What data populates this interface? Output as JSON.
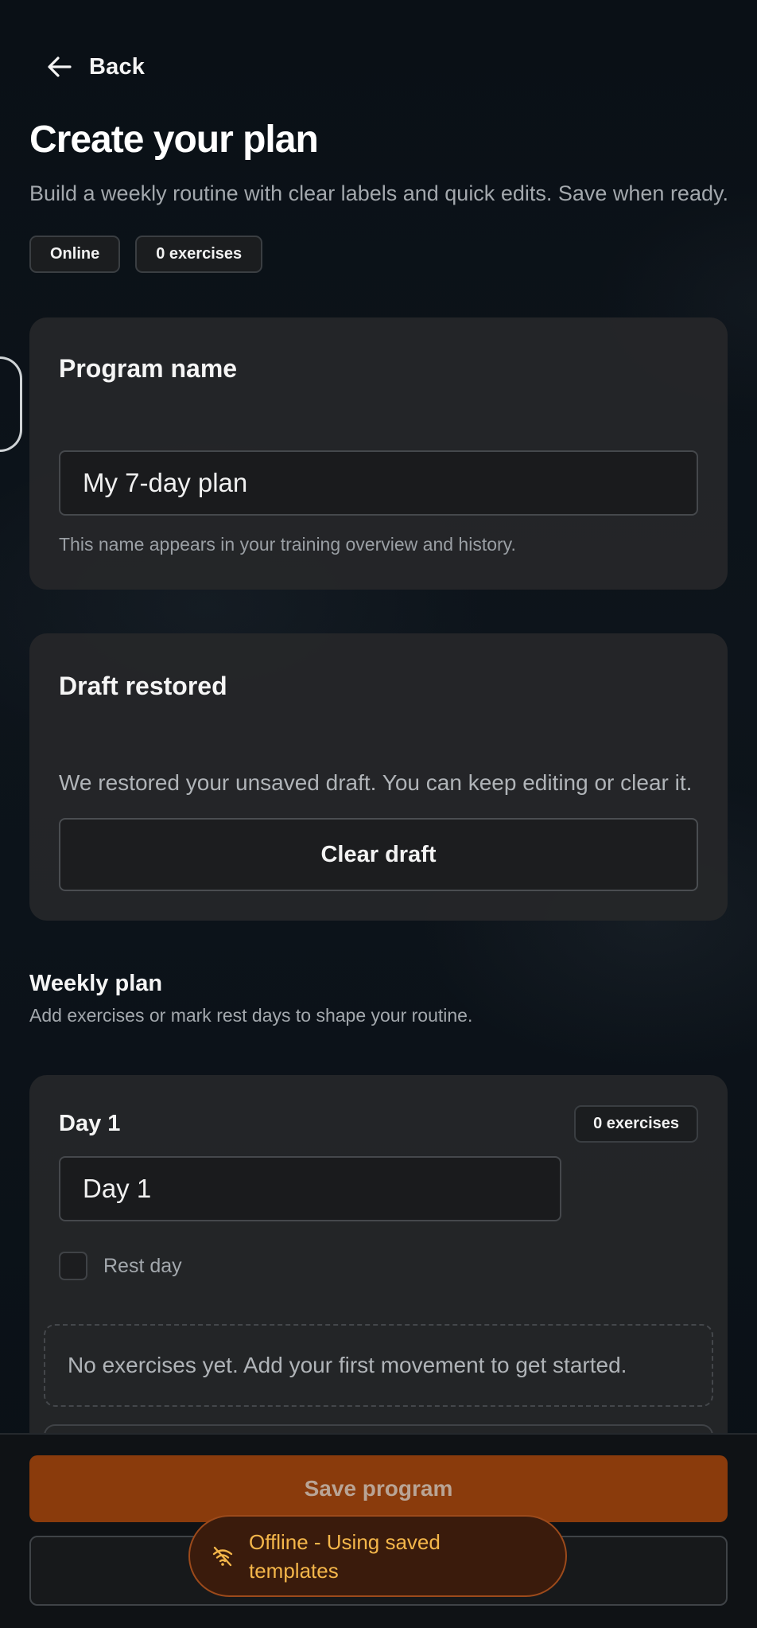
{
  "header": {
    "back_label": "Back",
    "title": "Create your plan",
    "subtitle": "Build a weekly routine with clear labels and quick edits. Save when ready.",
    "chips": [
      "Online",
      "0 exercises"
    ]
  },
  "program_card": {
    "title": "Program name",
    "input_value": "My 7-day plan",
    "helper": "This name appears in your training overview and history."
  },
  "draft_card": {
    "title": "Draft restored",
    "message": "We restored your unsaved draft. You can keep editing or clear it.",
    "clear_label": "Clear draft"
  },
  "weekly": {
    "title": "Weekly plan",
    "subtitle": "Add exercises or mark rest days to shape your routine."
  },
  "day": {
    "title": "Day 1",
    "count_chip": "0 exercises",
    "name_value": "Day 1",
    "rest_label": "Rest day",
    "rest_checked": false,
    "empty_message": "No exercises yet. Add your first movement to get started."
  },
  "footer": {
    "save_label": "Save program"
  },
  "toast": {
    "icon": "wifi-off-icon",
    "message": "Offline - Using saved templates"
  },
  "colors": {
    "background": "#0b1117",
    "card": "#262729",
    "accent": "#8a3b0c",
    "toast_text": "#f4b64a"
  }
}
